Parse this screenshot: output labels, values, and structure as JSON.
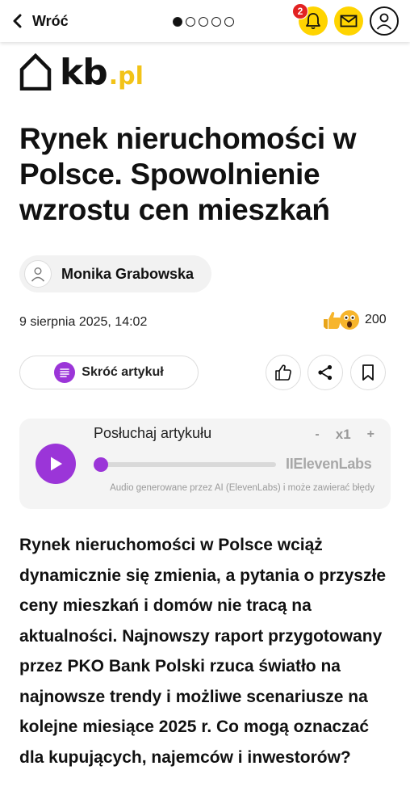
{
  "topbar": {
    "back_label": "Wróć",
    "pager": {
      "count": 5,
      "active": 1
    },
    "notification_count": "2",
    "accent": "#ffd400",
    "badge_color": "#e22222"
  },
  "logo": {
    "main": "kb",
    "suffix": ".pl"
  },
  "article": {
    "title": "Rynek nieruchomości w Polsce. Spowolnienie wzrostu cen mieszkań",
    "author": "Monika Grabowska",
    "date": "9 sierpnia 2025, 14:02",
    "reactions": {
      "icons": [
        "thumbs-up-emoji",
        "surprised-emoji"
      ],
      "count": "200"
    },
    "shorten_label": "Skróć artykuł",
    "lead": "Rynek nieruchomości w Polsce wciąż dynamicznie się zmienia, a pytania o przyszłe ceny mieszkań i domów nie tracą na aktualności. Najnowszy raport przygotowany przez PKO Bank Polski rzuca światło na najnowsze trendy i możliwe scenariusze na kolejne miesiące 2025 r. Co mogą oznaczać dla kupujących, najemców i inwestorów?"
  },
  "actions": [
    "like-icon",
    "share-icon",
    "bookmark-icon"
  ],
  "player": {
    "label": "Posłuchaj artykułu",
    "speed_minus": "-",
    "speed_value": "x1",
    "speed_plus": "+",
    "provider": "IIElevenLabs",
    "disclaimer": "Audio generowane przez AI (ElevenLabs) i może zawierać błędy",
    "progress": 0,
    "accent": "#9b35d8"
  }
}
